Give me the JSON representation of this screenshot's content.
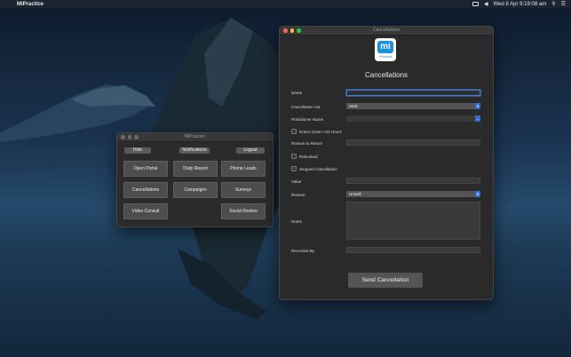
{
  "menubar": {
    "app_name": "MiPractice",
    "datetime": "Wed 8 Apr  9:19:08 am",
    "icons": [
      "apple-icon",
      "display-icon",
      "volume-icon",
      "search-icon",
      "list-icon"
    ]
  },
  "main_window": {
    "title": "MiPractice",
    "top_buttons": [
      "Hide",
      "Notifications",
      "Logout"
    ],
    "tiles": [
      "Open Portal",
      "Daily Report",
      "Phone Leads",
      "Cancellations",
      "Campaigns",
      "Surveys",
      "Video Consult",
      "Social Review"
    ]
  },
  "cancel_window": {
    "title": "Cancellations",
    "logo_mark": "mi",
    "logo_sub": "Practice",
    "heading": "Cancellations",
    "labels": {
      "name": "Name",
      "via": "Cancellation Via",
      "practitioner": "Practitioner Name",
      "notice": "Notice Given <24 Hours",
      "reason_return": "Reason to Return",
      "rebooked": "Rebooked",
      "stopped": "Stopped Cancellation",
      "value": "Value",
      "reason": "Reason",
      "notes": "Notes",
      "recorded_by": "Recorded By"
    },
    "via_value": "SMS",
    "reason_value": "Unwell",
    "send_button": "Send Cancellation"
  },
  "colors": {
    "accent": "#2f6fd0",
    "logo_blue": "#1b8fd8",
    "window_bg": "#2b2b2b"
  }
}
